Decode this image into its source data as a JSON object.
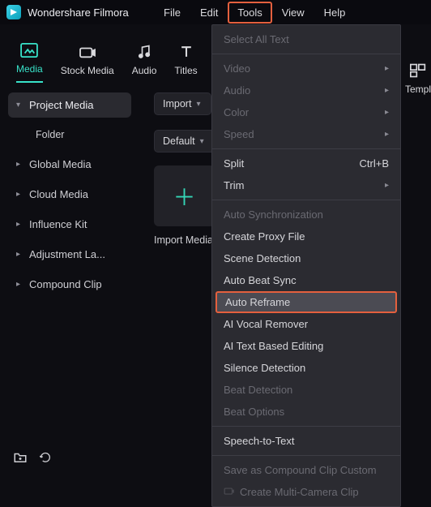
{
  "app": {
    "name": "Wondershare Filmora"
  },
  "menu": {
    "file": "File",
    "edit": "Edit",
    "tools": "Tools",
    "view": "View",
    "help": "Help"
  },
  "tabs": {
    "media": "Media",
    "stock_media": "Stock Media",
    "audio": "Audio",
    "titles": "Titles",
    "templates": "Templ"
  },
  "sidebar": {
    "project_media": "Project Media",
    "folder": "Folder",
    "global_media": "Global Media",
    "cloud_media": "Cloud Media",
    "influence_kit": "Influence Kit",
    "adjustment_layer": "Adjustment La...",
    "compound_clip": "Compound Clip"
  },
  "main": {
    "import_btn": "Import",
    "default_btn": "Default",
    "import_label": "Import Media"
  },
  "tools_menu": {
    "select_all_text": "Select All Text",
    "video": "Video",
    "audio": "Audio",
    "color": "Color",
    "speed": "Speed",
    "split": "Split",
    "split_shortcut": "Ctrl+B",
    "trim": "Trim",
    "auto_sync": "Auto Synchronization",
    "create_proxy": "Create Proxy File",
    "scene_detection": "Scene Detection",
    "auto_beat_sync": "Auto Beat Sync",
    "auto_reframe": "Auto Reframe",
    "ai_vocal_remover": "AI Vocal Remover",
    "ai_text_editing": "AI Text Based Editing",
    "silence_detection": "Silence Detection",
    "beat_detection": "Beat Detection",
    "beat_options": "Beat Options",
    "speech_to_text": "Speech-to-Text",
    "save_compound": "Save as Compound Clip Custom",
    "multi_camera": "Create Multi-Camera Clip"
  }
}
